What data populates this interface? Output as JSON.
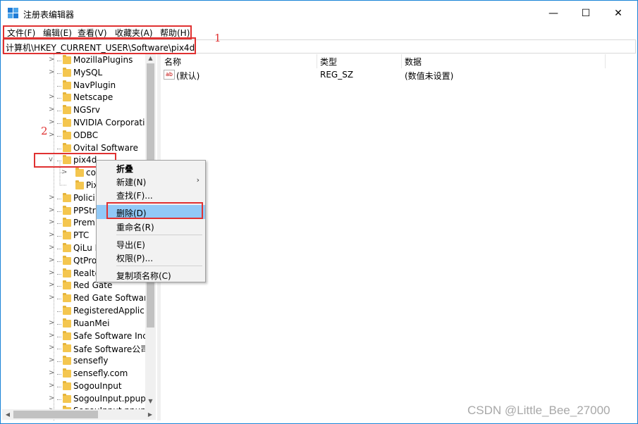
{
  "window": {
    "title": "注册表编辑器",
    "controls": {
      "minimize": "—",
      "maximize": "☐",
      "close": "✕"
    }
  },
  "menu": [
    "文件(F)",
    "编辑(E)",
    "查看(V)",
    "收藏夹(A)",
    "帮助(H)"
  ],
  "address": "计算机\\HKEY_CURRENT_USER\\Software\\pix4d",
  "annotations": [
    "1",
    "2"
  ],
  "tree": {
    "items": [
      {
        "label": "MozillaPlugins",
        "expander": ">"
      },
      {
        "label": "MySQL",
        "expander": ">"
      },
      {
        "label": "NavPlugin",
        "expander": ""
      },
      {
        "label": "Netscape",
        "expander": ">"
      },
      {
        "label": "NGSrv",
        "expander": ">"
      },
      {
        "label": "NVIDIA Corporatio",
        "expander": ">"
      },
      {
        "label": "ODBC",
        "expander": ">"
      },
      {
        "label": "Ovital Software",
        "expander": ""
      },
      {
        "label": "pix4d",
        "expander": "v"
      },
      {
        "label": "co",
        "expander": ">"
      },
      {
        "label": "Pix",
        "expander": ""
      },
      {
        "label": "Polici",
        "expander": ">"
      },
      {
        "label": "PPStr",
        "expander": ">"
      },
      {
        "label": "Prem",
        "expander": ">"
      },
      {
        "label": "PTC",
        "expander": ">"
      },
      {
        "label": "QiLu I",
        "expander": ">"
      },
      {
        "label": "QtPro",
        "expander": ">"
      },
      {
        "label": "Realte",
        "expander": ">"
      },
      {
        "label": "Red Gate",
        "expander": ">"
      },
      {
        "label": "Red Gate Softwar",
        "expander": ">"
      },
      {
        "label": "RegisteredApplic",
        "expander": ""
      },
      {
        "label": "RuanMei",
        "expander": ">"
      },
      {
        "label": "Safe Software Inc",
        "expander": ">"
      },
      {
        "label": "Safe Software公司",
        "expander": ">"
      },
      {
        "label": "sensefly",
        "expander": ">"
      },
      {
        "label": "sensefly.com",
        "expander": ">"
      },
      {
        "label": "SogouInput",
        "expander": ">"
      },
      {
        "label": "SogouInput.ppup",
        "expander": ">"
      },
      {
        "label": "SogouInput.ppup",
        "expander": ">"
      }
    ]
  },
  "list": {
    "columns": [
      "名称",
      "类型",
      "数据"
    ],
    "rows": [
      {
        "name": "(默认)",
        "type": "REG_SZ",
        "data": "(数值未设置)"
      }
    ]
  },
  "context_menu": {
    "items": [
      "折叠",
      "新建(N)",
      "查找(F)...",
      "删除(D)",
      "重命名(R)",
      "导出(E)",
      "权限(P)...",
      "复制项名称(C)"
    ],
    "submenu_arrow": "›"
  },
  "watermark": "CSDN @Little_Bee_27000"
}
